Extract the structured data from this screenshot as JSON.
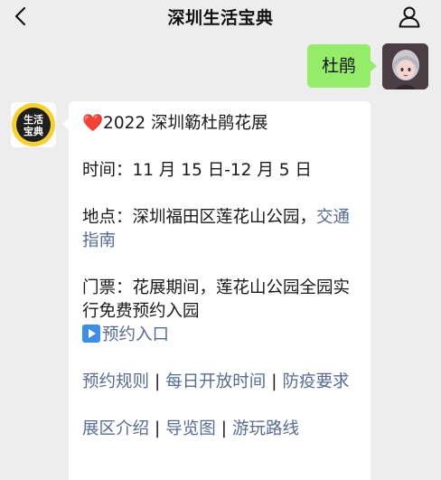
{
  "header": {
    "title": "深圳生活宝典"
  },
  "my_message": {
    "text": "杜鹃"
  },
  "bot_avatar": {
    "line1": "生活",
    "line2": "宝典"
  },
  "bot_message": {
    "headline_icon": "❤️",
    "headline": "2022 深圳簕杜鹃花展",
    "time": "时间：11 月 15 日-12 月 5 日",
    "location_prefix": "地点：深圳福田区莲花山公园，",
    "location_link": "交通指南",
    "ticket": "门票：花展期间，莲花山公园全园实行免费预约入园",
    "ticket_link": "预约入口",
    "links_row1": [
      "预约规则",
      "每日开放时间",
      "防疫要求"
    ],
    "separator": "|",
    "links_row2": [
      "展区介绍",
      "导览图",
      "游玩路线"
    ]
  },
  "colors": {
    "link": "#576b95",
    "my_bubble": "#95ec69",
    "background": "#ededed"
  }
}
